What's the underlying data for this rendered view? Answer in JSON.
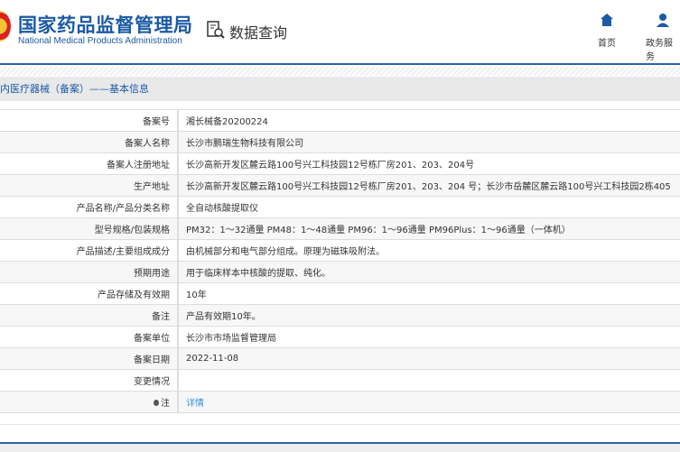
{
  "header": {
    "logo_cn": "国家药品监督管理局",
    "logo_en": "National Medical Products Administration",
    "data_query": "数据查询",
    "nav": [
      {
        "label": "首页",
        "icon": "home-icon"
      },
      {
        "label": "政务服务",
        "icon": "user-icon"
      }
    ]
  },
  "title": "内医疗器械（备案）——基本信息",
  "rows": [
    {
      "label": "备案号",
      "value": "湘长械备20200224"
    },
    {
      "label": "备案人名称",
      "value": "长沙市鹏瑞生物科技有限公司"
    },
    {
      "label": "备案人注册地址",
      "value": "长沙高新开发区麓云路100号兴工科技园12号栋厂房201、203、204号"
    },
    {
      "label": "生产地址",
      "value": "长沙高新开发区麓云路100号兴工科技园12号栋厂房201、203、204 号；长沙市岳麓区麓云路100号兴工科技园2栋405"
    },
    {
      "label": "产品名称/产品分类名称",
      "value": "全自动核酸提取仪"
    },
    {
      "label": "型号规格/包装规格",
      "value": "PM32：1～32通量 PM48：1～48通量 PM96：1～96通量 PM96Plus：1～96通量（一体机）"
    },
    {
      "label": "产品描述/主要组成成分",
      "value": "由机械部分和电气部分组成。原理为磁珠吸附法。"
    },
    {
      "label": "预期用途",
      "value": "用于临床样本中核酸的提取、纯化。"
    },
    {
      "label": "产品存储及有效期",
      "value": "10年"
    },
    {
      "label": "备注",
      "value": "产品有效期10年。"
    },
    {
      "label": "备案单位",
      "value": "长沙市市场监督管理局"
    },
    {
      "label": "备案日期",
      "value": "2022-11-08"
    },
    {
      "label": "变更情况",
      "value": ""
    },
    {
      "label": "注",
      "value": "详情"
    }
  ]
}
